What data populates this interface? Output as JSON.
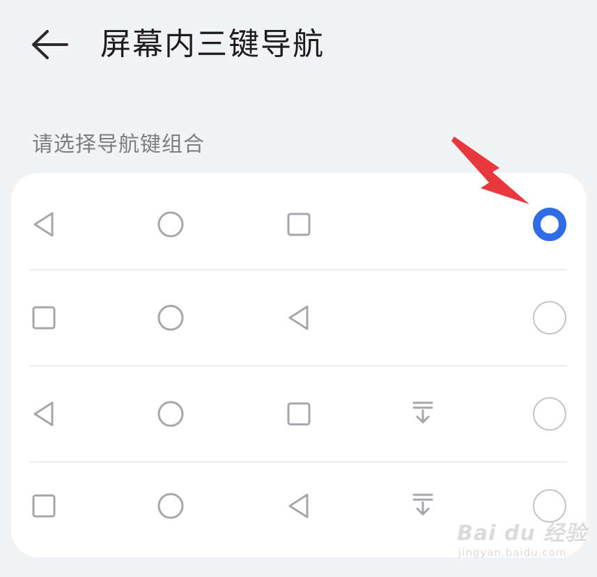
{
  "header": {
    "title": "屏幕内三键导航",
    "back_icon": "arrow-left-icon"
  },
  "section": {
    "label": "请选择导航键组合"
  },
  "options": [
    {
      "icons": [
        "back-triangle-icon",
        "home-circle-icon",
        "recents-square-icon"
      ],
      "selected": true
    },
    {
      "icons": [
        "recents-square-icon",
        "home-circle-icon",
        "back-triangle-icon"
      ],
      "selected": false
    },
    {
      "icons": [
        "back-triangle-icon",
        "home-circle-icon",
        "recents-square-icon",
        "notification-pulldown-icon"
      ],
      "selected": false
    },
    {
      "icons": [
        "recents-square-icon",
        "home-circle-icon",
        "back-triangle-icon",
        "notification-pulldown-icon"
      ],
      "selected": false
    }
  ],
  "colors": {
    "accent": "#2f6de6",
    "annotation_arrow": "#e8383d",
    "icon_stroke": "#a4a6ab"
  },
  "watermark": {
    "main": "Bai du 经验",
    "sub": "jingyan.baidu.com"
  }
}
